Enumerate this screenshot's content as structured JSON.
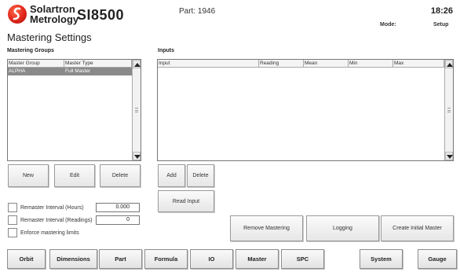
{
  "header": {
    "brand_line1": "Solartron",
    "brand_line2": "Metrology",
    "model": "SI8500",
    "part": "Part: 1946",
    "time": "18:26",
    "mode_label": "Mode:",
    "mode_value": "Setup"
  },
  "page_title": "Mastering Settings",
  "mastering_groups": {
    "label": "Mastering Groups",
    "columns": [
      "Master Group",
      "Master Type"
    ],
    "rows": [
      {
        "group": "ALPHA",
        "type": "Full Master",
        "selected": true
      }
    ],
    "buttons": {
      "new": "New",
      "edit": "Edit",
      "delete": "Delete"
    }
  },
  "inputs": {
    "label": "Inputs",
    "columns": [
      "Input",
      "Reading",
      "Mean",
      "Min",
      "Max"
    ],
    "buttons": {
      "add": "Add",
      "delete": "Delete",
      "read_input": "Read Input"
    }
  },
  "settings": {
    "remaster_hours_label": "Remaster Interval (Hours)",
    "remaster_hours_value": "0.000",
    "remaster_readings_label": "Remaster Interval (Readings)",
    "remaster_readings_value": "0",
    "enforce_limits_label": "Enforce mastering limits"
  },
  "actions": {
    "remove_mastering": "Remove Mastering",
    "logging": "Logging",
    "create_initial_master": "Create Initial Master"
  },
  "tabs": [
    "Orbit",
    "Dimensions",
    "Part",
    "Formula",
    "IO",
    "Master",
    "SPC",
    "System",
    "Gauge"
  ],
  "colors": {
    "logo_red": "#e1251b",
    "selected_row": "#8a8a8a"
  }
}
